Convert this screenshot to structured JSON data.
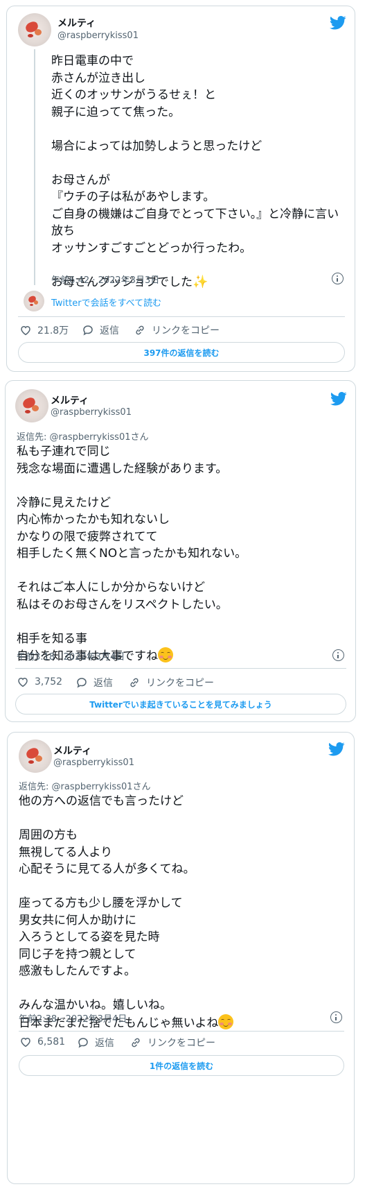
{
  "tweets": [
    {
      "name": "メルティ",
      "handle": "@raspberrykiss01",
      "text": "昨日電車の中で\n赤さんが泣き出し\n近くのオッサンがうるせぇ！と\n親子に迫ってて焦った。\n\n場合によっては加勢しようと思ったけど\n\nお母さんが\n『ウチの子は私があやします。\nご自身の機嫌はご自身でとって下さい。』と冷静に言い放ち\nオッサンすごすごとどっか行ったわ。\n\nお母さんグッジョブでした",
      "timestamp": "午前6:42 · 2022年3月3日",
      "conversation_link": "Twitterで会話をすべて読む",
      "likes": "21.8万",
      "reply_label": "返信",
      "copy_link_label": "リンクをコピー",
      "footer_button": "397件の返信を読む"
    },
    {
      "name": "メルティ",
      "handle": "@raspberrykiss01",
      "reply_to": "返信先: @raspberrykiss01さん",
      "text": "私も子連れで同じ\n残念な場面に遭遇した経験があります。\n\n冷静に見えたけど\n内心怖かったかも知れないし\nかなりの限で疲弊されてて\n相手したく無くNOと言ったかも知れない。\n\nそれはご本人にしか分からないけど\n私はそのお母さんをリスペクトしたい。\n\n相手を知る事\n自分を知る事は大事ですね",
      "timestamp": "午前3:18 · 2022年3月4日",
      "likes": "3,752",
      "reply_label": "返信",
      "copy_link_label": "リンクをコピー",
      "footer_button": "Twitterでいま起きていることを見てみましょう"
    },
    {
      "name": "メルティ",
      "handle": "@raspberrykiss01",
      "reply_to": "返信先: @raspberrykiss01さん",
      "text": "他の方への返信でも言ったけど\n\n周囲の方も\n無視してる人より\n心配そうに見てる人が多くてね。\n\n座ってる方も少し腰を浮かして\n男女共に何人か助けに\n入ろうとしてる姿を見た時\n同じ子を持つ親として\n感激もしたんですよ。\n\nみんな温かいね。嬉しいね。\n日本まだまだ捨てたもんじゃ無いよね",
      "timestamp": "午前2:38 · 2022年3月4日",
      "likes": "6,581",
      "reply_label": "返信",
      "copy_link_label": "リンクをコピー",
      "footer_button": "1件の返信を読む"
    }
  ],
  "colors": {
    "twitter_blue": "#1d9bf0",
    "muted": "#536471",
    "border": "#cfd9de"
  },
  "icons": [
    "twitter-bird-icon",
    "heart-icon",
    "reply-bubble-icon",
    "link-icon",
    "info-icon",
    "sparkles-icon",
    "relieved-face-icon",
    "smiling-face-icon"
  ]
}
